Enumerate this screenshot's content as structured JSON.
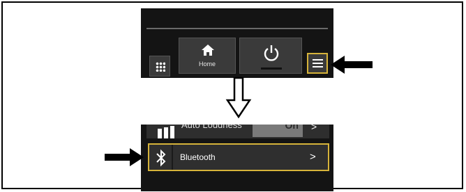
{
  "top_screen": {
    "home_label": "Home",
    "accent_color": "#d6b33a"
  },
  "bottom_screen": {
    "auto_loudness_label": "Auto Loudness",
    "auto_loudness_value": "On",
    "bluetooth_label": "Bluetooth",
    "chevron": ">"
  },
  "icons": [
    "grid-icon",
    "home-icon",
    "power-icon",
    "menu-icon",
    "bluetooth-icon",
    "chevron-right-icon",
    "arrow-left-icon",
    "arrow-down-icon",
    "arrow-right-icon"
  ]
}
